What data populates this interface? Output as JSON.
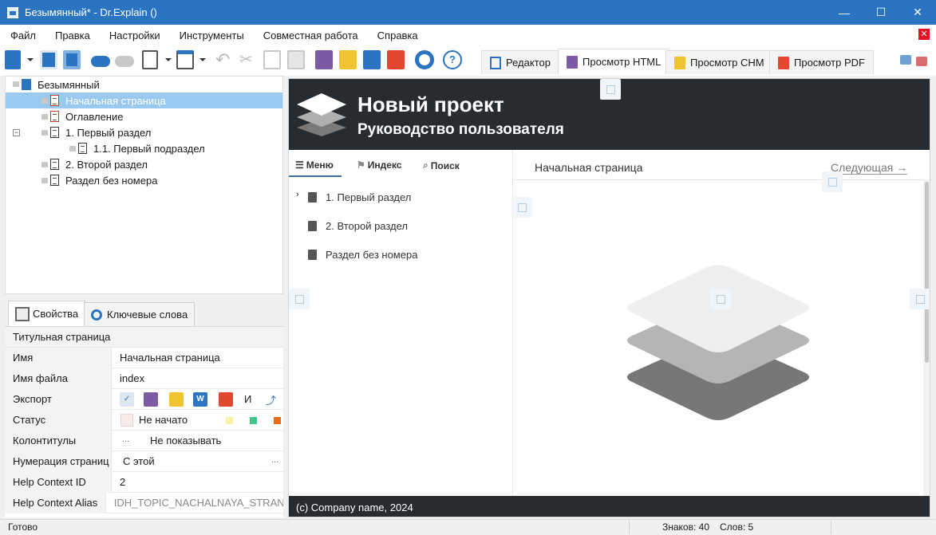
{
  "window": {
    "title": "Безымянный* - Dr.Explain ()",
    "minimize": "—",
    "maximize": "☐",
    "close": "✕"
  },
  "menu": {
    "items": [
      "Файл",
      "Правка",
      "Настройки",
      "Инструменты",
      "Совместная работа",
      "Справка"
    ]
  },
  "view_tabs": [
    {
      "label": "Редактор",
      "icon": "editor-icon"
    },
    {
      "label": "Просмотр HTML",
      "icon": "html-icon"
    },
    {
      "label": "Просмотр CHM",
      "icon": "chm-icon"
    },
    {
      "label": "Просмотр PDF",
      "icon": "pdf-icon"
    }
  ],
  "tree": {
    "root": "Безымянный",
    "items": [
      {
        "label": "Начальная страница",
        "selected": true
      },
      {
        "label": "Оглавление"
      },
      {
        "label": "1. Первый раздел",
        "expanded": true
      },
      {
        "label": "1.1. Первый подраздел"
      },
      {
        "label": "2. Второй раздел"
      },
      {
        "label": "Раздел без номера"
      }
    ]
  },
  "props_tabs": [
    "Свойства",
    "Ключевые слова"
  ],
  "props": {
    "section": "Титульная страница",
    "rows": [
      {
        "label": "Имя",
        "value": "Начальная страница"
      },
      {
        "label": "Имя файла",
        "value": "index"
      },
      {
        "label": "Экспорт",
        "value": "И"
      },
      {
        "label": "Статус",
        "value": "Не начато"
      },
      {
        "label": "Колонтитулы",
        "value": "Не показывать",
        "more": "..."
      },
      {
        "label": "Нумерация страниц",
        "value": "С этой",
        "more": "..."
      },
      {
        "label": "Help Context ID",
        "value": "2"
      },
      {
        "label": "Help Context Alias",
        "value": "IDH_TOPIC_NACHALNAYA_STRANIT"
      }
    ],
    "export_icons": [
      "W"
    ]
  },
  "preview": {
    "title": "Новый проект",
    "subtitle": "Руководство пользователя",
    "nav_tabs": [
      "Меню",
      "Индекс",
      "Поиск"
    ],
    "nav_items": [
      "1. Первый раздел",
      "2. Второй раздел",
      "Раздел без номера"
    ],
    "breadcrumb": "Начальная страница",
    "next_link": "Следующая →",
    "footer": "(c) Company name, 2024"
  },
  "status": {
    "ready": "Готово",
    "chars": "Знаков: 40",
    "words": "Слов: 5"
  },
  "colors": {
    "titlebar": "#2b74c2",
    "selection": "#99c9ef",
    "preview_header": "#272c30"
  }
}
